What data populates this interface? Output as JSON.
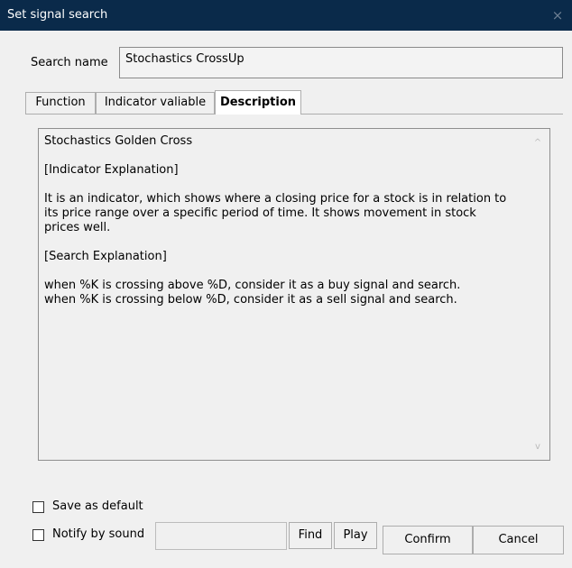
{
  "window": {
    "title": "Set signal search",
    "close_glyph": "×",
    "titlebar_color": "#0a2a4a"
  },
  "search": {
    "label": "Search name",
    "value": "Stochastics CrossUp"
  },
  "tabs": [
    {
      "label": "Function",
      "active": false
    },
    {
      "label": "Indicator valiable",
      "active": false
    },
    {
      "label": "Description",
      "active": true
    }
  ],
  "description": {
    "text": "Stochastics Golden Cross\n\n[Indicator Explanation]\n\nIt is an indicator, which shows where a closing price for a stock is in relation to its price range over a specific period of time. It shows movement in stock prices well.\n\n[Search Explanation]\n\nwhen %K is crossing above %D, consider it as a buy signal and search.\nwhen %K is crossing below %D, consider it as a sell signal and search.",
    "scroll_up_glyph": "^",
    "scroll_down_glyph": "v"
  },
  "options": {
    "save_default_label": "Save as default",
    "save_default_checked": false,
    "notify_sound_label": "Notify by sound",
    "notify_sound_checked": false,
    "sound_file_value": ""
  },
  "buttons": {
    "find": "Find",
    "play": "Play",
    "confirm": "Confirm",
    "cancel": "Cancel"
  }
}
